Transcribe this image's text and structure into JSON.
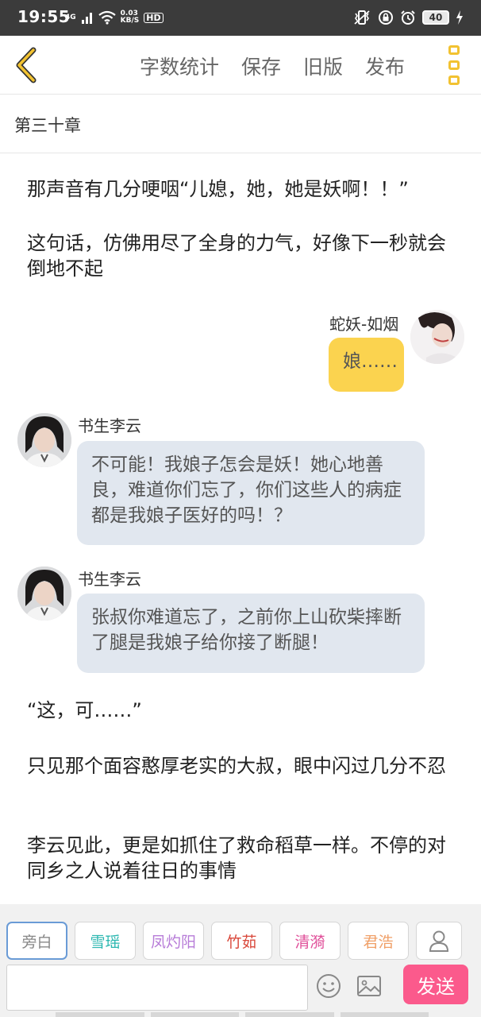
{
  "status_bar": {
    "time": "19:55",
    "network": "4G",
    "speed_value": "0.03",
    "speed_unit": "KB/S",
    "hd": "HD",
    "battery": "40"
  },
  "nav": {
    "back_icon": "chevron-left-icon",
    "actions": [
      "字数统计",
      "保存",
      "旧版",
      "发布"
    ],
    "more_icon": "vertical-dots-icon"
  },
  "chapter_title": "第三十章",
  "content": {
    "narration_1": "那声音有几分哽咽“儿媳，她，她是妖啊！！”",
    "narration_2": "这句话，仿佛用尽了全身的力气，好像下一秒就会倒地不起",
    "msg_1": {
      "speaker": "蛇妖-如烟",
      "text": "娘……"
    },
    "msg_2": {
      "speaker": "书生李云",
      "text": "不可能！我娘子怎会是妖！她心地善良，难道你们忘了，你们这些人的病症都是我娘子医好的吗！？"
    },
    "msg_3": {
      "speaker": "书生李云",
      "text": "张叔你难道忘了，之前你上山砍柴摔断了腿是我娘子给你接了断腿！"
    },
    "narration_3": "“这，可……”",
    "narration_4": "只见那个面容憨厚老实的大叔，眼中闪过几分不忍",
    "narration_5": "李云见此，更是如抓住了救命稻草一样。不停的对同乡之人说着往日的事情"
  },
  "roles": [
    {
      "label": "旁白",
      "color": "#888888"
    },
    {
      "label": "雪瑶",
      "color": "#2bb7b0"
    },
    {
      "label": "凤灼阳",
      "color": "#b77cd8"
    },
    {
      "label": "竹茹",
      "color": "#d9483b"
    },
    {
      "label": "清漪",
      "color": "#e0509a"
    },
    {
      "label": "君浩",
      "color": "#f0a068"
    }
  ],
  "input": {
    "value": "",
    "placeholder": ""
  },
  "send_label": "发送",
  "colors": {
    "accent_yellow": "#f2c231",
    "send_pink": "#fb5a8c",
    "bubble_gray": "#e1e7ef",
    "bubble_yellow": "#fbd34f"
  }
}
